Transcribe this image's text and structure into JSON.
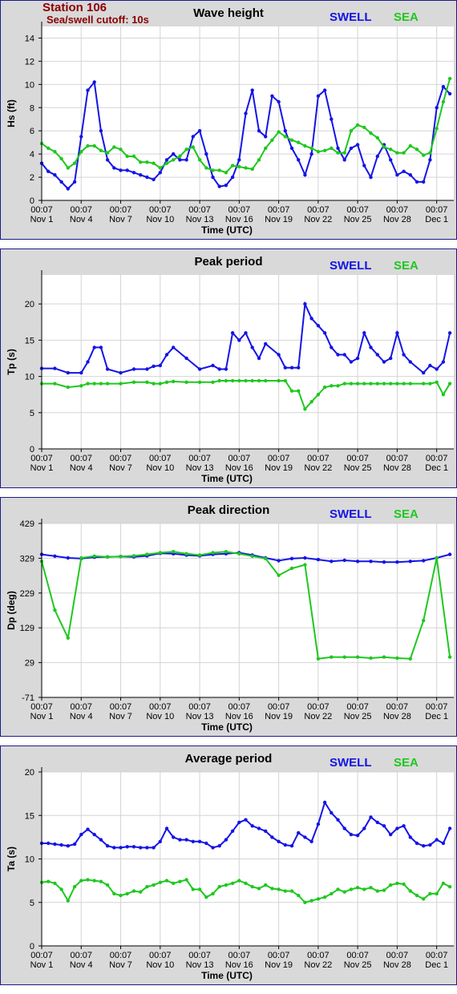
{
  "station": {
    "title": "Station 106",
    "cutoff": "Sea/swell cutoff: 10s"
  },
  "legend": {
    "swell": "SWELL",
    "sea": "SEA"
  },
  "colors": {
    "swell": "#1414e6",
    "sea": "#1ec81e",
    "frame": "#1a1a8c",
    "panel": "#d9d9d9"
  },
  "x_axis": {
    "label": "Time (UTC)",
    "ticks_top": [
      "00:07",
      "00:07",
      "00:07",
      "00:07",
      "00:07",
      "00:07",
      "00:07",
      "00:07",
      "00:07",
      "00:07",
      "00:07"
    ],
    "ticks_bottom": [
      "Nov 1",
      "Nov 4",
      "Nov 7",
      "Nov 10",
      "Nov 13",
      "Nov 16",
      "Nov 19",
      "Nov 22",
      "Nov 25",
      "Nov 28",
      "Dec 1"
    ],
    "tick_days": [
      0,
      3,
      6,
      9,
      12,
      15,
      18,
      21,
      24,
      27,
      30
    ],
    "range_days": [
      0,
      31.3
    ]
  },
  "chart_data": [
    {
      "type": "line",
      "title": "Wave height",
      "ylabel": "Hs (ft)",
      "xlabel": "Time (UTC)",
      "ylim": [
        0,
        15
      ],
      "yticks": [
        0,
        2,
        4,
        6,
        8,
        10,
        12,
        14
      ],
      "grid": true,
      "legend_position": "top-right",
      "x_days": [
        0,
        0.5,
        1,
        1.5,
        2,
        2.5,
        3,
        3.5,
        4,
        4.5,
        5,
        5.5,
        6,
        6.5,
        7,
        7.5,
        8,
        8.5,
        9,
        9.5,
        10,
        10.5,
        11,
        11.5,
        12,
        12.5,
        13,
        13.5,
        14,
        14.5,
        15,
        15.5,
        16,
        16.5,
        17,
        17.5,
        18,
        18.5,
        19,
        19.5,
        20,
        20.5,
        21,
        21.5,
        22,
        22.5,
        23,
        23.5,
        24,
        24.5,
        25,
        25.5,
        26,
        26.5,
        27,
        27.5,
        28,
        28.5,
        29,
        29.5,
        30,
        30.5,
        31
      ],
      "series": [
        {
          "name": "SWELL",
          "values": [
            3.2,
            2.5,
            2.2,
            1.6,
            1.0,
            1.6,
            5.5,
            9.5,
            10.2,
            6,
            3.5,
            2.8,
            2.6,
            2.6,
            2.4,
            2.2,
            2,
            1.8,
            2.4,
            3.5,
            4,
            3.5,
            3.5,
            5.5,
            6,
            4,
            2,
            1.2,
            1.3,
            2,
            3.5,
            7.5,
            9.5,
            6,
            5.5,
            9,
            8.5,
            6,
            4.5,
            3.5,
            2.2,
            4,
            9,
            9.5,
            7,
            4.5,
            3.5,
            4.5,
            4.8,
            3,
            2,
            3.8,
            4.8,
            3.5,
            2.2,
            2.5,
            2.2,
            1.6,
            1.6,
            3.5,
            8,
            9.8,
            9.2
          ]
        },
        {
          "name": "SEA",
          "values": [
            4.9,
            4.5,
            4.2,
            3.6,
            2.8,
            3.2,
            4.2,
            4.7,
            4.7,
            4.3,
            4.1,
            4.6,
            4.4,
            3.8,
            3.8,
            3.3,
            3.3,
            3.2,
            2.8,
            3.2,
            3.5,
            3.8,
            4.4,
            4.6,
            3.5,
            2.8,
            2.6,
            2.6,
            2.4,
            3.0,
            2.9,
            2.8,
            2.7,
            3.5,
            4.5,
            5.2,
            5.9,
            5.5,
            5.2,
            5,
            4.7,
            4.5,
            4.2,
            4.3,
            4.5,
            4.1,
            4.1,
            6,
            6.5,
            6.3,
            5.8,
            5.4,
            4.6,
            4.4,
            4.1,
            4.1,
            4.7,
            4.4,
            3.9,
            4.1,
            6.2,
            8.5,
            10.5
          ]
        }
      ]
    },
    {
      "type": "line",
      "title": "Peak period",
      "ylabel": "Tp (s)",
      "xlabel": "Time (UTC)",
      "ylim": [
        0,
        24
      ],
      "yticks": [
        0,
        5,
        10,
        15,
        20
      ],
      "grid": true,
      "legend_position": "top-right",
      "x_days": [
        0,
        1,
        2,
        3,
        3.5,
        4,
        4.5,
        5,
        6,
        7,
        8,
        8.5,
        9,
        9.5,
        10,
        11,
        12,
        13,
        13.5,
        14,
        14.5,
        15,
        15.5,
        16,
        16.5,
        17,
        18,
        18.5,
        19,
        19.5,
        20,
        20.5,
        21,
        21.5,
        22,
        22.5,
        23,
        23.5,
        24,
        24.5,
        25,
        25.5,
        26,
        26.5,
        27,
        27.5,
        28,
        29,
        29.5,
        30,
        30.5,
        31
      ],
      "series": [
        {
          "name": "SWELL",
          "values": [
            11.1,
            11.1,
            10.5,
            10.5,
            12,
            14,
            14,
            11,
            10.5,
            11,
            11,
            11.4,
            11.5,
            13,
            14,
            12.5,
            11,
            11.5,
            11,
            11,
            16,
            15,
            16,
            14,
            12.5,
            14.5,
            13,
            11.2,
            11.2,
            11.2,
            20,
            18,
            17,
            16,
            14,
            13,
            13,
            12,
            12.5,
            16,
            14,
            13,
            12,
            12.5,
            16,
            13,
            12,
            10.5,
            11.5,
            11,
            12,
            16
          ]
        },
        {
          "name": "SEA",
          "values": [
            9,
            9,
            8.5,
            8.7,
            9,
            9,
            9,
            9,
            9,
            9.2,
            9.2,
            9,
            9,
            9.2,
            9.3,
            9.2,
            9.2,
            9.2,
            9.4,
            9.4,
            9.4,
            9.4,
            9.4,
            9.4,
            9.4,
            9.4,
            9.4,
            9.4,
            8,
            8,
            5.5,
            6.5,
            7.5,
            8.5,
            8.7,
            8.7,
            9,
            9,
            9,
            9,
            9,
            9,
            9,
            9,
            9,
            9,
            9,
            9,
            9,
            9.2,
            7.5,
            9
          ]
        }
      ]
    },
    {
      "type": "line",
      "title": "Peak direction",
      "ylabel": "Dp (deg)",
      "xlabel": "Time (UTC)",
      "ylim": [
        -71,
        429
      ],
      "yticks": [
        -71,
        29,
        129,
        229,
        329,
        429
      ],
      "grid": true,
      "legend_position": "top-right",
      "x_days": [
        0,
        1,
        2,
        3,
        4,
        5,
        6,
        7,
        8,
        9,
        10,
        11,
        12,
        13,
        14,
        15,
        16,
        17,
        18,
        19,
        20,
        21,
        22,
        23,
        24,
        25,
        26,
        27,
        28,
        29,
        30,
        31
      ],
      "series": [
        {
          "name": "SWELL",
          "values": [
            340,
            335,
            330,
            328,
            332,
            333,
            334,
            333,
            336,
            343,
            342,
            338,
            336,
            340,
            342,
            345,
            338,
            330,
            322,
            328,
            330,
            325,
            320,
            323,
            320,
            320,
            318,
            318,
            320,
            322,
            330,
            340
          ]
        },
        {
          "name": "SEA",
          "values": [
            320,
            180,
            100,
            330,
            335,
            333,
            334,
            336,
            340,
            345,
            348,
            342,
            338,
            345,
            348,
            342,
            335,
            328,
            280,
            300,
            310,
            40,
            45,
            45,
            45,
            42,
            45,
            42,
            40,
            150,
            330,
            45
          ]
        }
      ]
    },
    {
      "type": "line",
      "title": "Average period",
      "ylabel": "Ta (s)",
      "xlabel": "Time (UTC)",
      "ylim": [
        0,
        20
      ],
      "yticks": [
        0,
        5,
        10,
        15,
        20
      ],
      "grid": true,
      "legend_position": "top-right",
      "x_days": [
        0,
        0.5,
        1,
        1.5,
        2,
        2.5,
        3,
        3.5,
        4,
        4.5,
        5,
        5.5,
        6,
        6.5,
        7,
        7.5,
        8,
        8.5,
        9,
        9.5,
        10,
        10.5,
        11,
        11.5,
        12,
        12.5,
        13,
        13.5,
        14,
        14.5,
        15,
        15.5,
        16,
        16.5,
        17,
        17.5,
        18,
        18.5,
        19,
        19.5,
        20,
        20.5,
        21,
        21.5,
        22,
        22.5,
        23,
        23.5,
        24,
        24.5,
        25,
        25.5,
        26,
        26.5,
        27,
        27.5,
        28,
        28.5,
        29,
        29.5,
        30,
        30.5,
        31
      ],
      "series": [
        {
          "name": "SWELL",
          "values": [
            11.8,
            11.8,
            11.7,
            11.6,
            11.5,
            11.7,
            12.8,
            13.4,
            12.8,
            12.2,
            11.5,
            11.3,
            11.3,
            11.4,
            11.4,
            11.3,
            11.3,
            11.3,
            12,
            13.5,
            12.5,
            12.2,
            12.2,
            12,
            12,
            11.8,
            11.3,
            11.5,
            12.2,
            13.2,
            14.2,
            14.5,
            13.8,
            13.5,
            13.2,
            12.5,
            12,
            11.6,
            11.5,
            13,
            12.5,
            12,
            14,
            16.5,
            15.3,
            14.5,
            13.5,
            12.8,
            12.7,
            13.5,
            14.8,
            14.2,
            13.8,
            12.8,
            13.5,
            13.8,
            12.5,
            11.8,
            11.5,
            11.6,
            12.2,
            11.8,
            13.5
          ]
        },
        {
          "name": "SEA",
          "values": [
            7.3,
            7.4,
            7.2,
            6.5,
            5.2,
            6.8,
            7.5,
            7.6,
            7.5,
            7.4,
            7,
            6,
            5.8,
            6,
            6.3,
            6.2,
            6.8,
            7,
            7.3,
            7.5,
            7.2,
            7.4,
            7.6,
            6.5,
            6.5,
            5.6,
            6,
            6.8,
            7,
            7.2,
            7.5,
            7.2,
            6.8,
            6.6,
            7,
            6.6,
            6.5,
            6.3,
            6.3,
            5.8,
            5,
            5.2,
            5.4,
            5.6,
            6,
            6.5,
            6.2,
            6.5,
            6.7,
            6.5,
            6.7,
            6.3,
            6.4,
            7,
            7.2,
            7.1,
            6.3,
            5.8,
            5.4,
            6,
            6,
            7.2,
            6.8
          ]
        }
      ]
    }
  ]
}
